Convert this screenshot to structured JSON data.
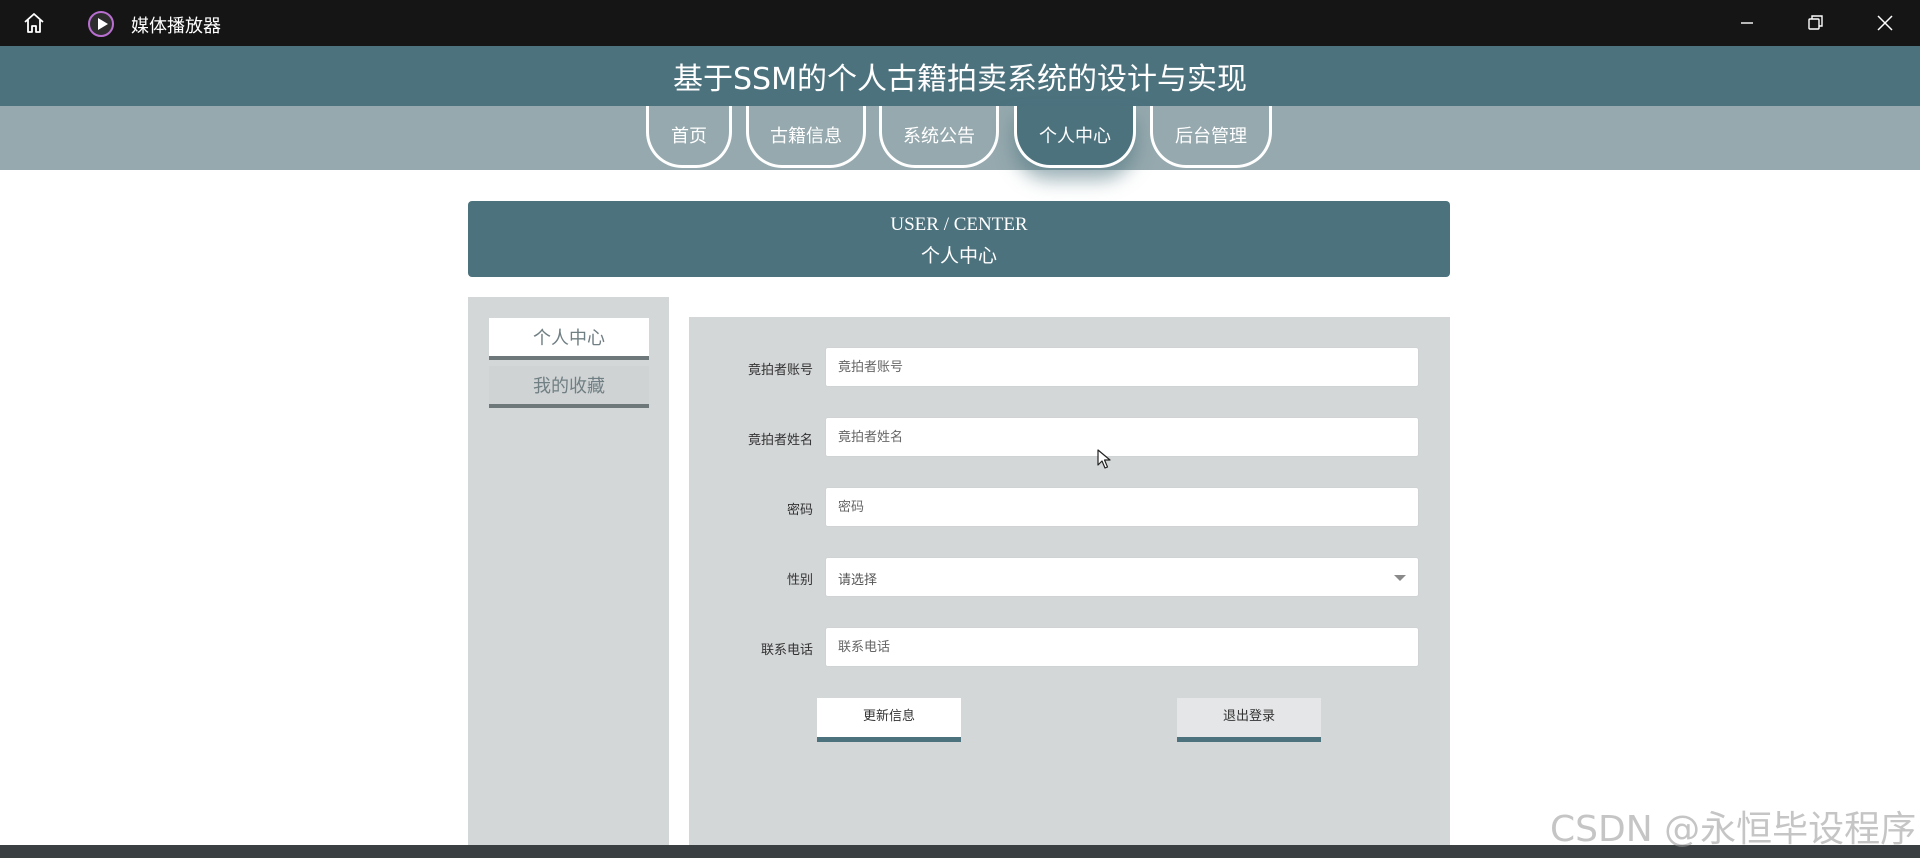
{
  "window": {
    "app_title": "媒体播放器",
    "home_icon": "home-icon",
    "app_icon": "play-icon",
    "controls": [
      "minimize-icon",
      "restore-icon",
      "close-icon"
    ]
  },
  "header": {
    "site_title": "基于SSM的个人古籍拍卖系统的设计与实现",
    "accent_color": "#4c727e",
    "nav_bg_color": "#95a9ae"
  },
  "nav": {
    "items": [
      "首页",
      "古籍信息",
      "系统公告",
      "个人中心",
      "后台管理"
    ],
    "active": "个人中心"
  },
  "banner": {
    "en": "USER / CENTER",
    "cn": "个人中心"
  },
  "side_menu": {
    "items": [
      "个人中心",
      "我的收藏"
    ],
    "active": "个人中心"
  },
  "form": {
    "account": {
      "label": "竟拍者账号",
      "placeholder": "竟拍者账号",
      "value": ""
    },
    "name": {
      "label": "竟拍者姓名",
      "placeholder": "竟拍者姓名",
      "value": ""
    },
    "password": {
      "label": "密码",
      "placeholder": "密码",
      "value": ""
    },
    "gender": {
      "label": "性别",
      "selected": "请选择"
    },
    "phone": {
      "label": "联系电话",
      "placeholder": "联系电话",
      "value": ""
    },
    "update_button": "更新信息",
    "logout_button": "退出登录"
  },
  "watermark": "CSDN @永恒毕设程序"
}
